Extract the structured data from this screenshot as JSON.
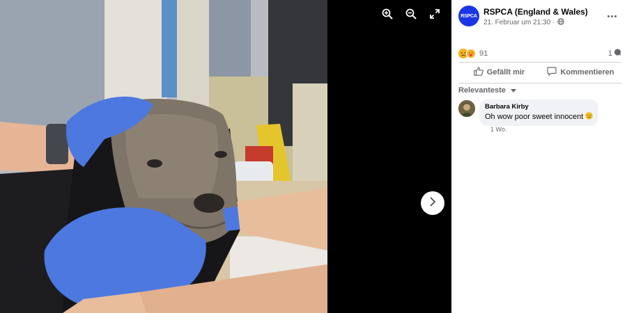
{
  "viewer": {
    "tools": [
      "zoom-in-icon",
      "zoom-out-icon",
      "fullscreen-icon"
    ],
    "next_icon": "chevron-right-icon",
    "photo": "veterinary staff in blue gloves holding a dog with severe skin disease"
  },
  "post": {
    "avatar_text": "RSPCA",
    "page_name": "RSPCA (England & Wales)",
    "date": "21. Februar um 21:30",
    "separator": "·",
    "privacy_icon": "globe-icon"
  },
  "reactions": {
    "count": "91",
    "types": [
      "sad",
      "care"
    ],
    "comments_count": "1"
  },
  "actions": {
    "like_label": "Gefällt mir",
    "comment_label": "Kommentieren"
  },
  "comments": {
    "sort_label": "Relevanteste",
    "items": [
      {
        "author": "Barbara Kirby",
        "text": "Oh wow poor sweet innocent",
        "emoji": "crying-face",
        "time": "1 Wo."
      }
    ]
  },
  "colors": {
    "brand": "#1b36e6",
    "text_secondary": "#65676b",
    "bubble": "#f0f2f5",
    "glove": "#4d78e0"
  }
}
